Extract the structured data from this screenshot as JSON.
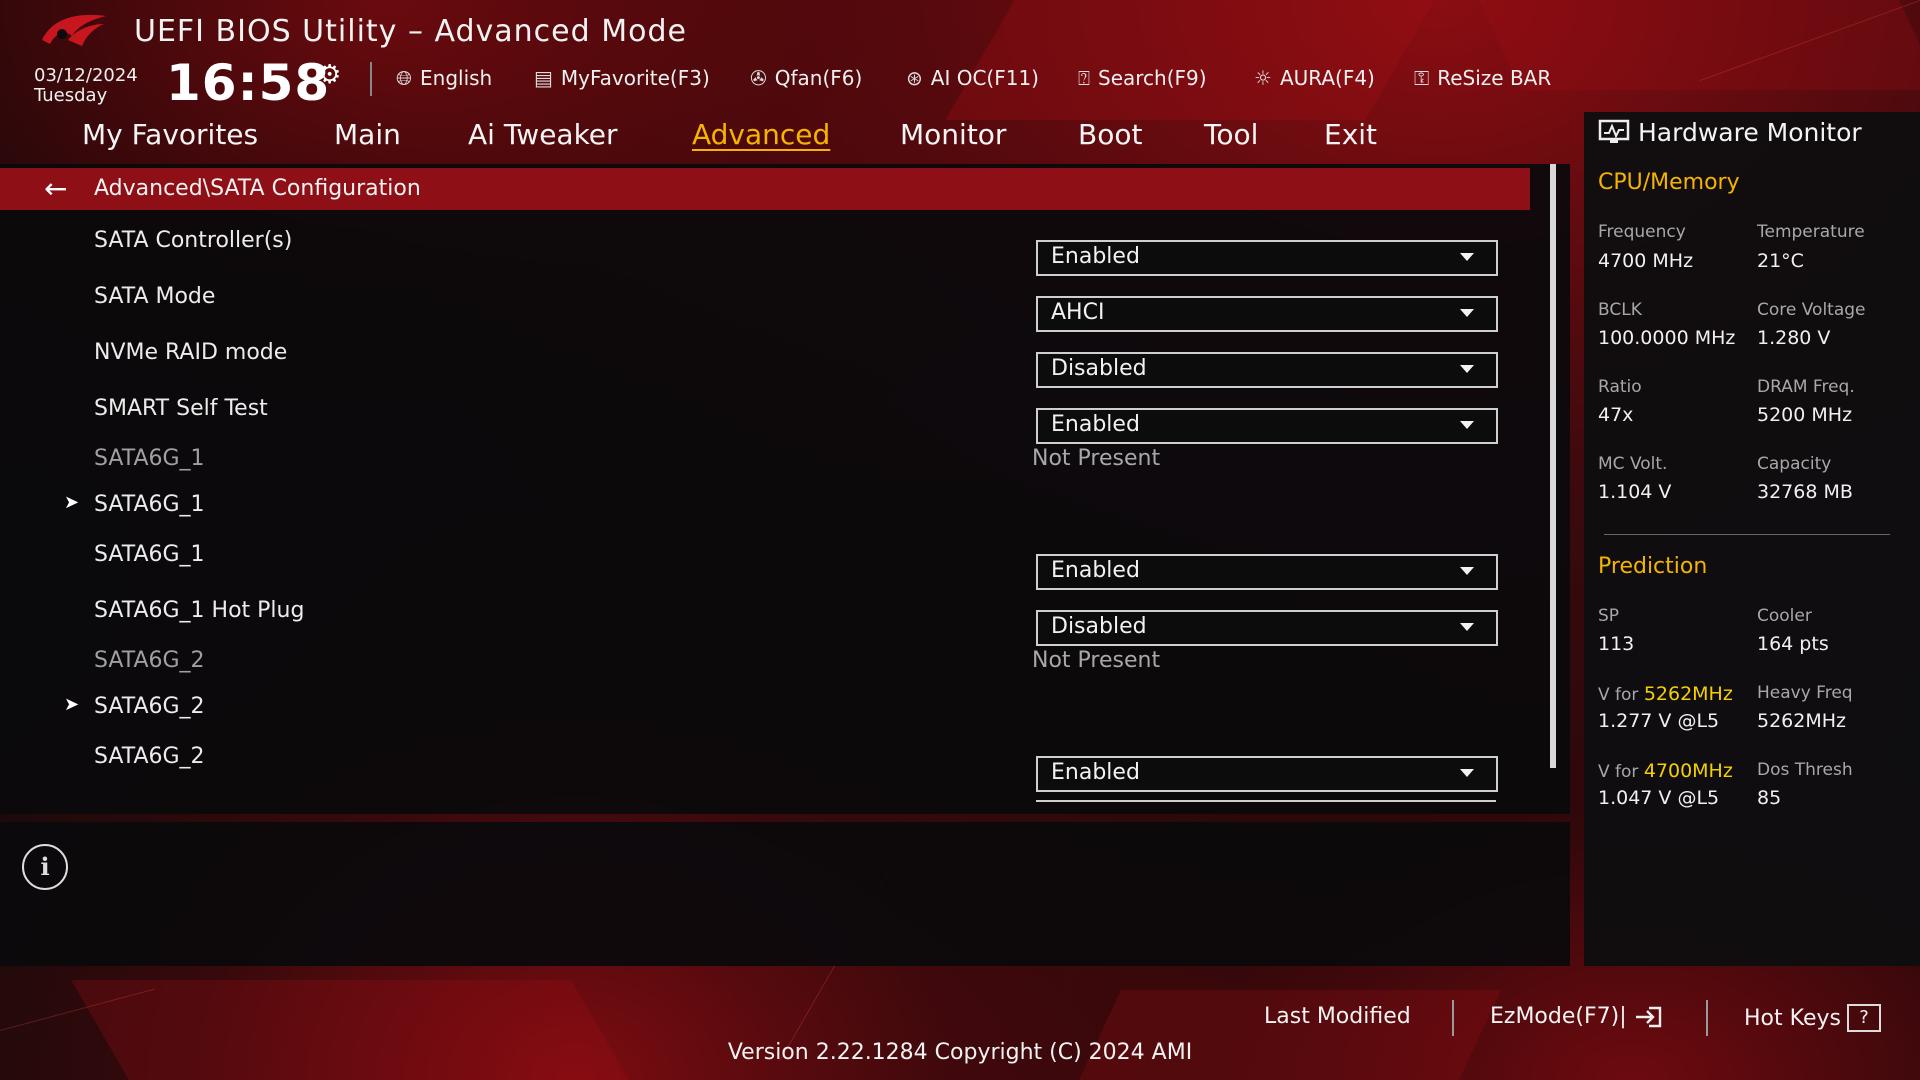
{
  "header": {
    "title": "UEFI BIOS Utility – Advanced Mode",
    "date": "03/12/2024",
    "day": "Tuesday",
    "time": "16:58",
    "toolbar": [
      {
        "label": "English",
        "icon": "globe-icon"
      },
      {
        "label": "MyFavorite(F3)",
        "icon": "favorite-icon"
      },
      {
        "label": "Qfan(F6)",
        "icon": "fan-icon"
      },
      {
        "label": "AI OC(F11)",
        "icon": "ai-oc-icon"
      },
      {
        "label": "Search(F9)",
        "icon": "search-icon"
      },
      {
        "label": "AURA(F4)",
        "icon": "aura-icon"
      },
      {
        "label": "ReSize BAR",
        "icon": "resize-bar-icon"
      }
    ]
  },
  "tabs": [
    "My Favorites",
    "Main",
    "Ai Tweaker",
    "Advanced",
    "Monitor",
    "Boot",
    "Tool",
    "Exit"
  ],
  "active_tab": "Advanced",
  "breadcrumb": "Advanced\\SATA Configuration",
  "settings": [
    {
      "label": "SATA Controller(s)",
      "value": "Enabled"
    },
    {
      "label": "SATA Mode",
      "value": "AHCI"
    },
    {
      "label": "NVMe RAID mode",
      "value": "Disabled"
    },
    {
      "label": "SMART Self Test",
      "value": "Enabled"
    },
    {
      "label": "SATA6G_1",
      "status": "Not Present"
    },
    {
      "label": "SATA6G_1",
      "submenu": true
    },
    {
      "label": "SATA6G_1",
      "value": "Enabled"
    },
    {
      "label": "SATA6G_1 Hot Plug",
      "value": "Disabled"
    },
    {
      "label": "SATA6G_2",
      "status": "Not Present"
    },
    {
      "label": "SATA6G_2",
      "submenu": true
    },
    {
      "label": "SATA6G_2",
      "value": "Enabled"
    }
  ],
  "hardware_monitor": {
    "title": "Hardware Monitor",
    "cpu_memory": {
      "section": "CPU/Memory",
      "frequency_label": "Frequency",
      "frequency": "4700 MHz",
      "temperature_label": "Temperature",
      "temperature": "21°C",
      "bclk_label": "BCLK",
      "bclk": "100.0000 MHz",
      "core_voltage_label": "Core Voltage",
      "core_voltage": "1.280 V",
      "ratio_label": "Ratio",
      "ratio": "47x",
      "dram_freq_label": "DRAM Freq.",
      "dram_freq": "5200 MHz",
      "mc_volt_label": "MC Volt.",
      "mc_volt": "1.104 V",
      "capacity_label": "Capacity",
      "capacity": "32768 MB"
    },
    "prediction": {
      "section": "Prediction",
      "sp_label": "SP",
      "sp": "113",
      "cooler_label": "Cooler",
      "cooler": "164 pts",
      "v_for_label": "V for ",
      "v_for_1_freq": "5262MHz",
      "v_for_1": "1.277 V @L5",
      "heavy_freq_label": "Heavy Freq",
      "heavy_freq": "5262MHz",
      "v_for_2_freq": "4700MHz",
      "v_for_2": "1.047 V @L5",
      "dos_thresh_label": "Dos Thresh",
      "dos_thresh": "85"
    }
  },
  "footer": {
    "last_modified": "Last Modified",
    "ezmode": "EzMode(F7)|",
    "hot_keys": "Hot Keys",
    "hot_keys_glyph": "?",
    "version": "Version 2.22.1284 Copyright (C) 2024 AMI"
  },
  "colors": {
    "accent": "#f5b400",
    "highlight": "#f5d000",
    "breadcrumb_bg": "#8e1016"
  }
}
